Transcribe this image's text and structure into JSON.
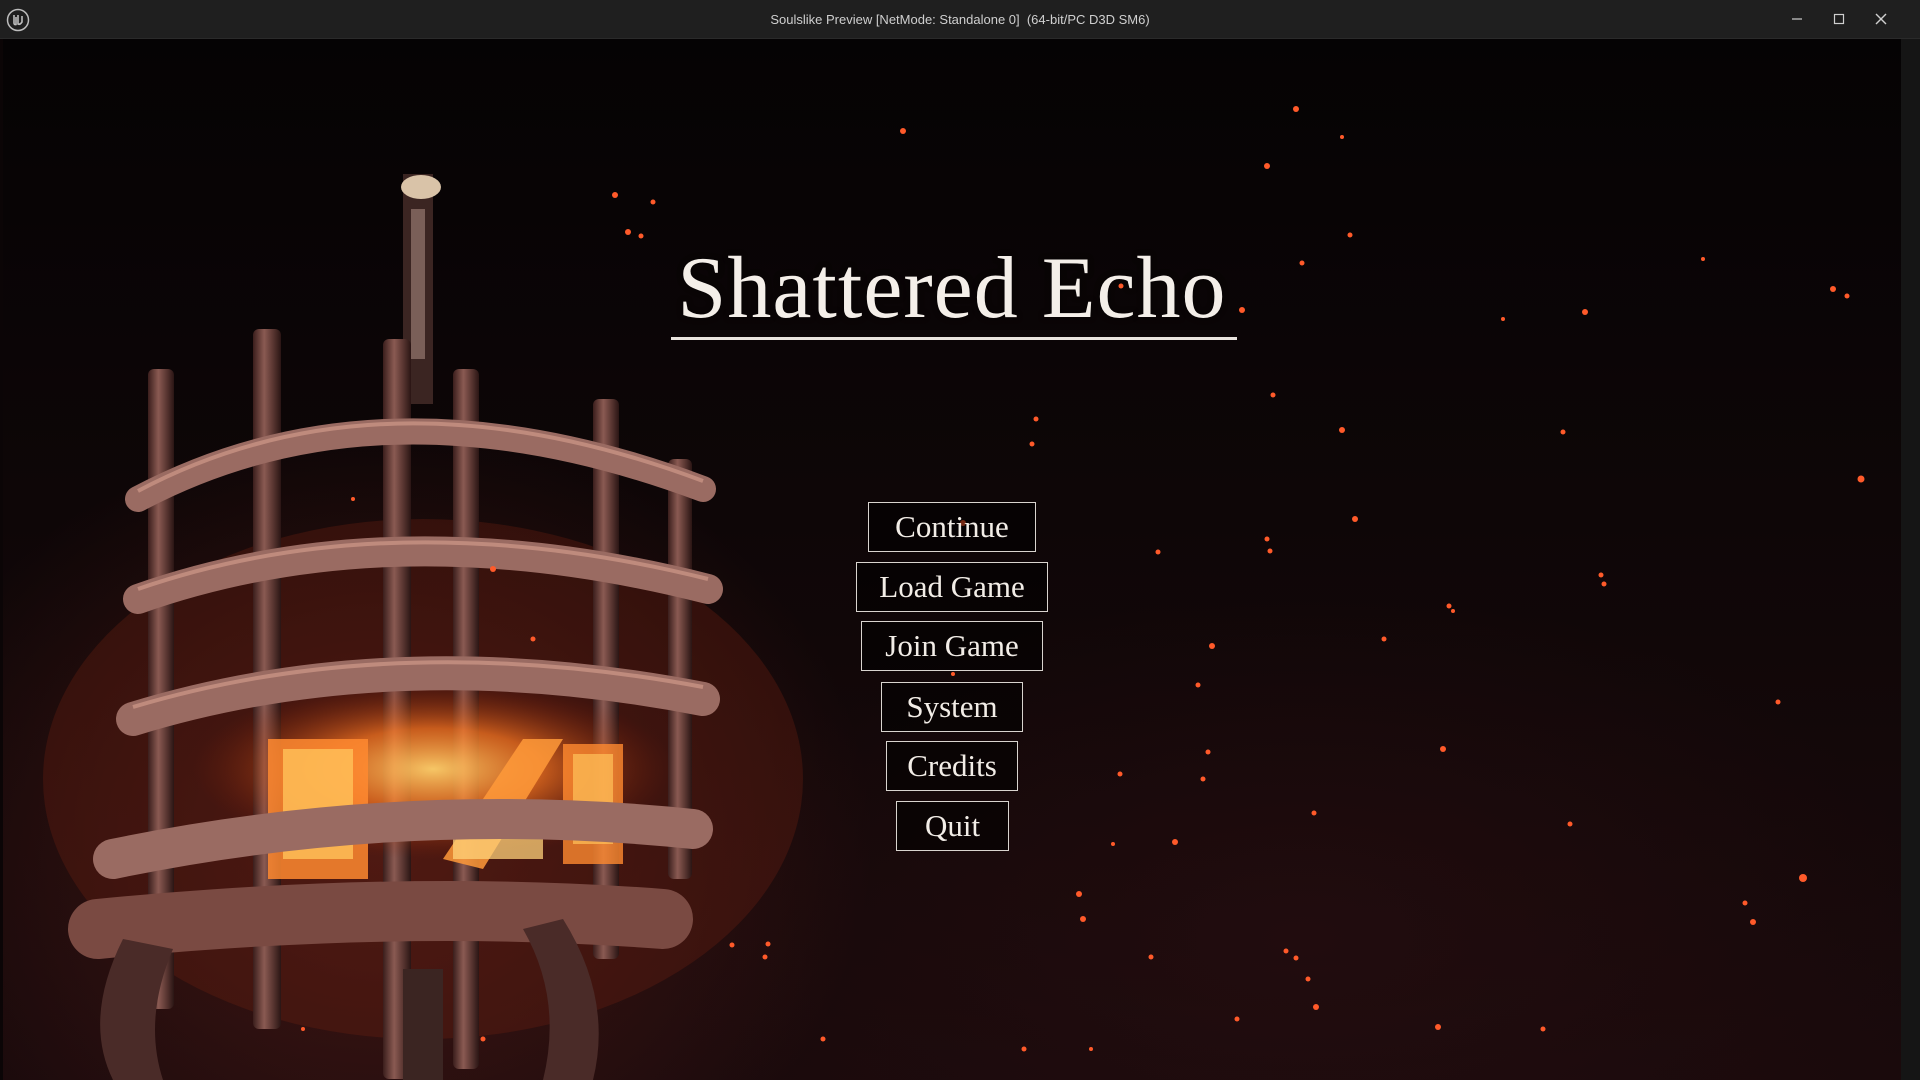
{
  "window": {
    "title": "Soulslike Preview [NetMode: Standalone 0]  (64-bit/PC D3D SM6)",
    "app_icon": "unreal-engine-icon",
    "controls": [
      "minimize-icon",
      "maximize-icon",
      "close-icon"
    ]
  },
  "game": {
    "title": "Shattered Echo"
  },
  "menu": {
    "continue_label": "Continue",
    "load_label": "Load Game",
    "join_label": "Join Game",
    "system_label": "System",
    "credits_label": "Credits",
    "quit_label": "Quit"
  },
  "colors": {
    "background": "#0b0506",
    "ember": "#ff5a2a",
    "fire": "#ff8a30",
    "text": "#f4efe9",
    "button_border": "#d9d4cf"
  }
}
